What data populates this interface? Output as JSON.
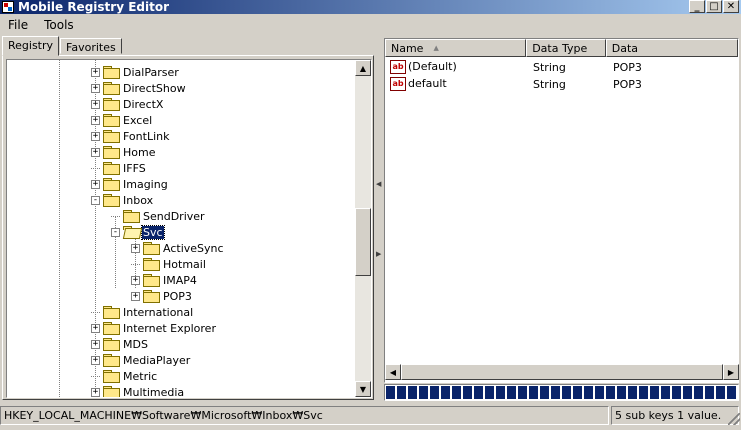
{
  "window": {
    "title": "Mobile Registry Editor",
    "minimize": "_",
    "maximize": "□",
    "close": "✕"
  },
  "menu": [
    "File",
    "Tools"
  ],
  "tabs": [
    {
      "label": "Registry",
      "active": true
    },
    {
      "label": "Favorites",
      "active": false
    }
  ],
  "tree": [
    {
      "label": "DialParser",
      "expander": "+"
    },
    {
      "label": "DirectShow",
      "expander": "+"
    },
    {
      "label": "DirectX",
      "expander": "+"
    },
    {
      "label": "Excel",
      "expander": "+"
    },
    {
      "label": "FontLink",
      "expander": "+"
    },
    {
      "label": "Home",
      "expander": "+"
    },
    {
      "label": "IFFS",
      "expander": ""
    },
    {
      "label": "Imaging",
      "expander": "+"
    },
    {
      "label": "Inbox",
      "expander": "-"
    },
    {
      "label": "SendDriver",
      "expander": ""
    },
    {
      "label": "Svc",
      "expander": "-",
      "selected": true
    },
    {
      "label": "ActiveSync",
      "expander": "+"
    },
    {
      "label": "Hotmail",
      "expander": ""
    },
    {
      "label": "IMAP4",
      "expander": "+"
    },
    {
      "label": "POP3",
      "expander": "+"
    },
    {
      "label": "International",
      "expander": ""
    },
    {
      "label": "Internet Explorer",
      "expander": "+"
    },
    {
      "label": "MDS",
      "expander": "+"
    },
    {
      "label": "MediaPlayer",
      "expander": "+"
    },
    {
      "label": "Metric",
      "expander": ""
    },
    {
      "label": "Multimedia",
      "expander": "+"
    }
  ],
  "list": {
    "columns": [
      "Name",
      "Data Type",
      "Data"
    ],
    "rows": [
      {
        "name": "(Default)",
        "type": "String",
        "data": "POP3"
      },
      {
        "name": "default",
        "type": "String",
        "data": "POP3"
      }
    ]
  },
  "string_icon_text": "ab",
  "progress": {
    "value_percent": 100
  },
  "status": {
    "path": "HKEY_LOCAL_MACHINE₩Software₩Microsoft₩Inbox₩Svc",
    "summary": "5 sub keys 1 value."
  }
}
